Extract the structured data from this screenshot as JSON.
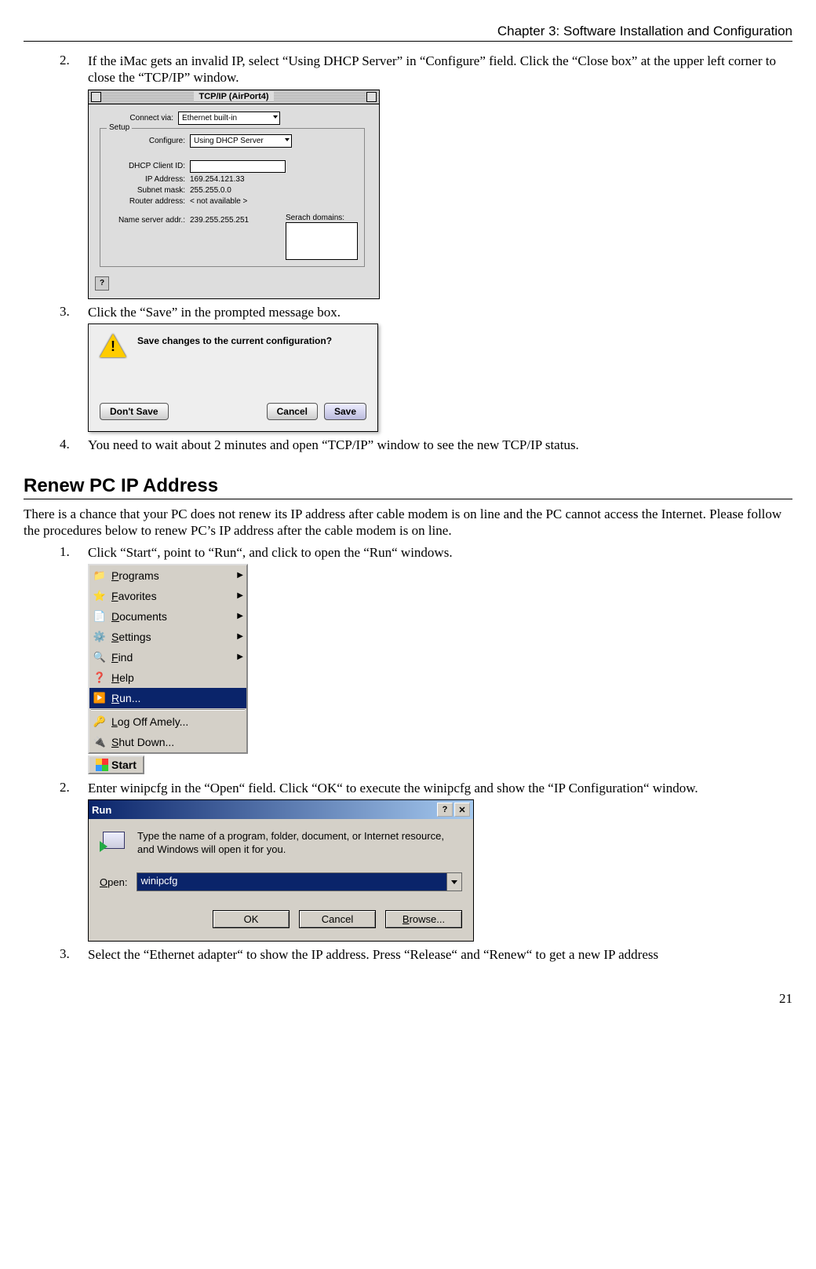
{
  "header": {
    "chapter": "Chapter 3: Software Installation and Configuration"
  },
  "page_number": "21",
  "steps_a": {
    "n2": "2.",
    "t2": "If the iMac gets an invalid IP, select “Using DHCP Server” in “Configure” field. Click the “Close box” at the upper left corner to close the “TCP/IP” window.",
    "n3": "3.",
    "t3": "Click the “Save” in the prompted message box.",
    "n4": "4.",
    "t4": "You need to wait about 2 minutes and open “TCP/IP” window to see the new TCP/IP status."
  },
  "section": {
    "title": "Renew PC IP Address",
    "intro": "There is a chance that your PC does not renew its IP address after cable modem is on line and the PC cannot access the Internet. Please follow the procedures below to renew PC’s IP address after the cable modem is on line."
  },
  "steps_b": {
    "n1": "1.",
    "t1": "Click “Start“, point to “Run“, and click to open the “Run“ windows.",
    "n2": "2.",
    "t2": "Enter winipcfg in the “Open“ field. Click “OK“ to execute the winipcfg and show the “IP Configuration“ window.",
    "n3": "3.",
    "t3": "Select the “Ethernet adapter“ to show the IP address. Press “Release“ and “Renew“ to get a new IP address"
  },
  "tcpip": {
    "title": "TCP/IP (AirPort4)",
    "connect_label": "Connect via:",
    "connect_value": "Ethernet built-in",
    "setup_legend": "Setup",
    "configure_label": "Configure:",
    "configure_value": "Using DHCP Server",
    "dhcp_label": "DHCP Client ID:",
    "ip_label": "IP Address:",
    "ip_value": "169.254.121.33",
    "subnet_label": "Subnet mask:",
    "subnet_value": "255.255.0.0",
    "router_label": "Router address:",
    "router_value": "< not available >",
    "ns_label": "Name server addr.:",
    "ns_value": "239.255.255.251",
    "search_label": "Serach domains:",
    "help": "?"
  },
  "save_dlg": {
    "message": "Save changes to the current configuration?",
    "dont_save": "Don't Save",
    "cancel": "Cancel",
    "save": "Save"
  },
  "start_menu": {
    "items": [
      {
        "icon": "📁",
        "label": "Programs",
        "underline": "P",
        "arrow": true
      },
      {
        "icon": "⭐",
        "label": "Favorites",
        "underline": "F",
        "arrow": true
      },
      {
        "icon": "📄",
        "label": "Documents",
        "underline": "D",
        "arrow": true
      },
      {
        "icon": "⚙️",
        "label": "Settings",
        "underline": "S",
        "arrow": true
      },
      {
        "icon": "🔍",
        "label": "Find",
        "underline": "F",
        "arrow": true
      },
      {
        "icon": "❓",
        "label": "Help",
        "underline": "H",
        "arrow": false
      },
      {
        "icon": "▶️",
        "label": "Run...",
        "underline": "R",
        "arrow": false,
        "selected": true
      }
    ],
    "sep_items": [
      {
        "icon": "🔑",
        "label": "Log Off Amely...",
        "underline": "L"
      },
      {
        "icon": "🔌",
        "label": "Shut Down...",
        "underline": "S"
      }
    ],
    "start_label": "Start"
  },
  "run_dlg": {
    "title": "Run",
    "help_btn": "?",
    "close_btn": "✕",
    "desc": "Type the name of a program, folder, document, or Internet resource, and Windows will open it for you.",
    "open_label": "Open:",
    "open_value": "winipcfg",
    "ok": "OK",
    "cancel": "Cancel",
    "browse": "Browse..."
  }
}
